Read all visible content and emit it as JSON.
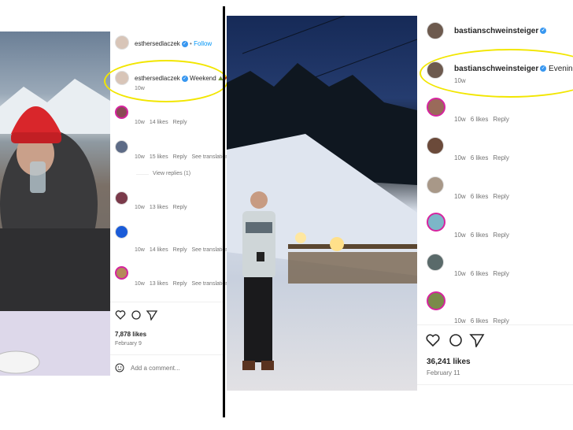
{
  "left_post": {
    "header": {
      "username": "esthersedlaczek",
      "follow": "Follow"
    },
    "caption": {
      "username": "esthersedlaczek",
      "text": "Weekend",
      "age": "10w"
    },
    "comments": [
      {
        "age": "10w",
        "likes": "14 likes",
        "reply": "Reply"
      },
      {
        "age": "10w",
        "likes": "15 likes",
        "reply": "Reply",
        "translate": "See translation"
      },
      {
        "age": "10w",
        "likes": "13 likes",
        "reply": "Reply"
      },
      {
        "age": "10w",
        "likes": "14 likes",
        "reply": "Reply",
        "translate": "See translation"
      },
      {
        "age": "10w",
        "likes": "13 likes",
        "reply": "Reply",
        "translate": "See translation"
      }
    ],
    "view_replies": "View replies (1)",
    "likes": "7,878 likes",
    "date": "February 9",
    "add_comment_placeholder": "Add a comment..."
  },
  "right_post": {
    "header": {
      "username": "bastianschweinsteiger"
    },
    "caption": {
      "username": "bastianschweinsteiger",
      "text": "Evening i",
      "age": "10w"
    },
    "comments": [
      {
        "age": "10w",
        "likes": "6 likes",
        "reply": "Reply"
      },
      {
        "age": "10w",
        "likes": "6 likes",
        "reply": "Reply"
      },
      {
        "age": "10w",
        "likes": "6 likes",
        "reply": "Reply"
      },
      {
        "age": "10w",
        "likes": "6 likes",
        "reply": "Reply"
      },
      {
        "age": "10w",
        "likes": "6 likes",
        "reply": "Reply"
      },
      {
        "age": "10w",
        "likes": "6 likes",
        "reply": "Reply"
      }
    ],
    "likes": "36,241 likes",
    "date": "February 11"
  },
  "colors": {
    "highlight": "#f2e600",
    "verified": "#3897f0",
    "follow": "#0095f6",
    "divider": "#000000"
  },
  "icons": [
    "heart-icon",
    "comment-icon",
    "share-icon",
    "verified-icon",
    "emoji-icon"
  ]
}
